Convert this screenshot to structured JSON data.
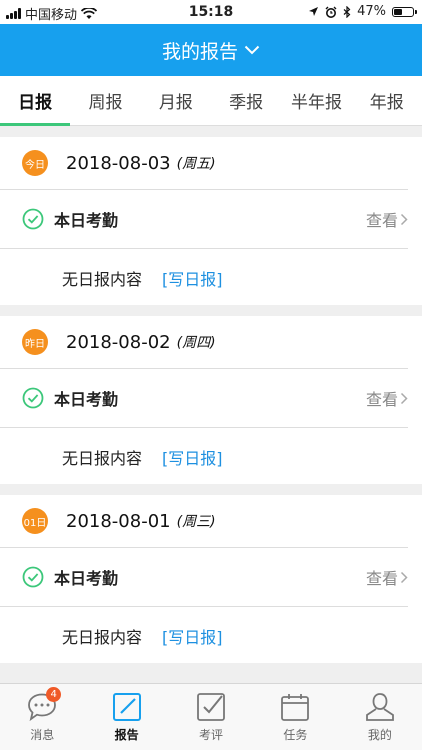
{
  "status_bar": {
    "carrier": "中国移动",
    "time": "15:18",
    "battery": "47%",
    "battery_level": 0.47
  },
  "header": {
    "title": "我的报告"
  },
  "tabs": [
    {
      "label": "日报",
      "active": true
    },
    {
      "label": "周报",
      "active": false
    },
    {
      "label": "月报",
      "active": false
    },
    {
      "label": "季报",
      "active": false
    },
    {
      "label": "半年报",
      "active": false
    },
    {
      "label": "年报",
      "active": false
    }
  ],
  "reports": [
    {
      "badge": "今日",
      "date": "2018-08-03",
      "weekday": "(周五)",
      "attendance_label": "本日考勤",
      "view_label": "查看",
      "content_text": "无日报内容",
      "write_label": "[写日报]"
    },
    {
      "badge": "昨日",
      "date": "2018-08-02",
      "weekday": "(周四)",
      "attendance_label": "本日考勤",
      "view_label": "查看",
      "content_text": "无日报内容",
      "write_label": "[写日报]"
    },
    {
      "badge": "01日",
      "date": "2018-08-01",
      "weekday": "(周三)",
      "attendance_label": "本日考勤",
      "view_label": "查看",
      "content_text": "无日报内容",
      "write_label": "[写日报]"
    }
  ],
  "bottom_nav": [
    {
      "label": "消息",
      "icon": "chat-icon",
      "badge": "4",
      "active": false
    },
    {
      "label": "报告",
      "icon": "edit-report-icon",
      "active": true
    },
    {
      "label": "考评",
      "icon": "checkbox-icon",
      "active": false
    },
    {
      "label": "任务",
      "icon": "calendar-icon",
      "active": false
    },
    {
      "label": "我的",
      "icon": "person-icon",
      "active": false
    }
  ],
  "colors": {
    "primary": "#17a0ee",
    "accent_green": "#3cc77a",
    "badge_orange": "#f5901e",
    "link_blue": "#1e90e0"
  }
}
